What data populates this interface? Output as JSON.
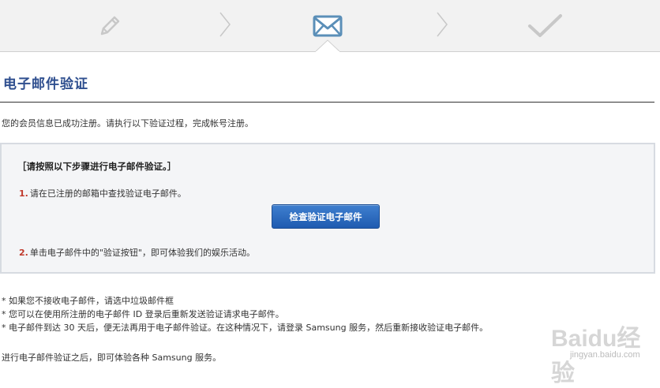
{
  "stepbar": {
    "steps": [
      {
        "icon": "pencil-icon",
        "state": "done"
      },
      {
        "icon": "envelope-icon",
        "state": "active"
      },
      {
        "icon": "checkmark-icon",
        "state": "pending"
      }
    ],
    "colors": {
      "inactive": "#c8c8c8",
      "active": "#5b8fb8"
    }
  },
  "page": {
    "title": "电子邮件验证",
    "intro": "您的会员信息已成功注册。请执行以下验证过程，完成帐号注册。"
  },
  "steps_box": {
    "heading": "［请按照以下步骤进行电子邮件验证。］",
    "step1_num": "1.",
    "step1_text": "请在已注册的邮箱中查找验证电子邮件。",
    "button_label": "检查验证电子邮件",
    "step2_num": "2.",
    "step2_text": "单击电子邮件中的\"验证按钮\"，即可体验我们的娱乐活动。"
  },
  "notes": [
    "* 如果您不接收电子邮件，请选中垃圾邮件框",
    "* 您可以在使用所注册的电子邮件 ID 登录后重新发送验证请求电子邮件。",
    "* 电子邮件到达 30 天后，便无法再用于电子邮件验证。在这种情况下，请登录 Samsung 服务，然后重新接收验证电子邮件。"
  ],
  "footer": "进行电子邮件验证之后，即可体验各种 Samsung 服务。",
  "watermark": {
    "logo": "Baidu经验",
    "url": "jingyan.baidu.com"
  }
}
